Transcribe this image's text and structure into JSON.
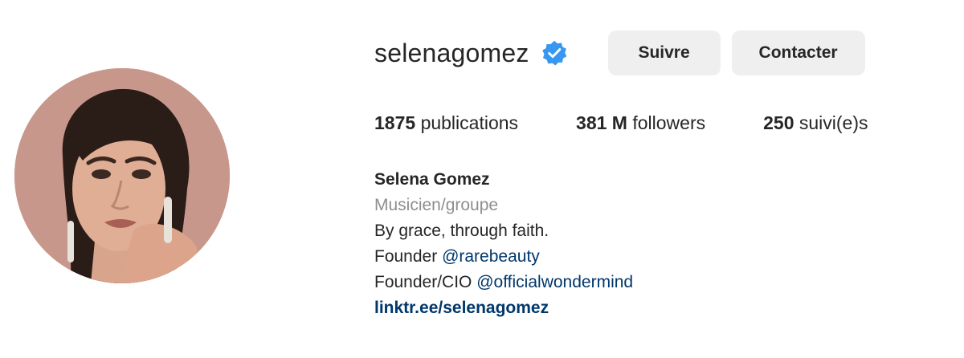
{
  "profile": {
    "username": "selenagomez",
    "verified_icon": "verified-badge-icon",
    "accent_color": "#0095f6",
    "link_color": "#00376b",
    "follow_label": "Suivre",
    "contact_label": "Contacter"
  },
  "stats": {
    "posts_count": "1875",
    "posts_label": "publications",
    "followers_count": "381 M",
    "followers_label": "followers",
    "following_count": "250",
    "following_label": "suivi(e)s"
  },
  "bio": {
    "name": "Selena Gomez",
    "category": "Musicien/groupe",
    "line1": "By grace, through faith.",
    "line2_prefix": "Founder",
    "line2_mention": "@rarebeauty",
    "line3_prefix": "Founder/CIO",
    "line3_mention": "@officialwondermind",
    "link": "linktr.ee/selenagomez"
  }
}
